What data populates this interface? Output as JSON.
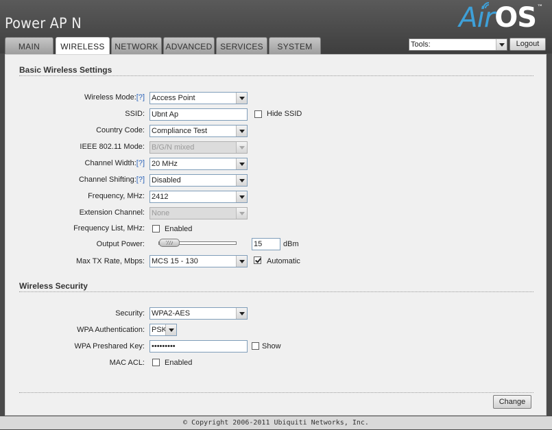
{
  "header": {
    "device_title": "Power AP N",
    "logo_air": "Air",
    "logo_os": "OS",
    "logo_tm": "™"
  },
  "tabs": [
    {
      "label": "MAIN",
      "active": false
    },
    {
      "label": "WIRELESS",
      "active": true
    },
    {
      "label": "NETWORK",
      "active": false
    },
    {
      "label": "ADVANCED",
      "active": false
    },
    {
      "label": "SERVICES",
      "active": false
    },
    {
      "label": "SYSTEM",
      "active": false
    }
  ],
  "toolbar": {
    "tools_value": "Tools:",
    "logout_label": "Logout"
  },
  "basic": {
    "title": "Basic Wireless Settings",
    "help": "[?]",
    "wireless_mode": {
      "label": "Wireless Mode:",
      "value": "Access Point"
    },
    "ssid": {
      "label": "SSID:",
      "value": "Ubnt Ap",
      "hide_label": "Hide SSID",
      "hide_checked": false
    },
    "country_code": {
      "label": "Country Code:",
      "value": "Compliance Test"
    },
    "ieee_mode": {
      "label": "IEEE 802.11 Mode:",
      "value": "B/G/N mixed"
    },
    "channel_width": {
      "label": "Channel Width:",
      "value": "20 MHz"
    },
    "channel_shifting": {
      "label": "Channel Shifting:",
      "value": "Disabled"
    },
    "frequency": {
      "label": "Frequency, MHz:",
      "value": "2412"
    },
    "extension_channel": {
      "label": "Extension Channel:",
      "value": "None"
    },
    "frequency_list": {
      "label": "Frequency List, MHz:",
      "enabled_label": "Enabled",
      "checked": false
    },
    "output_power": {
      "label": "Output Power:",
      "value": "15",
      "unit": "dBm"
    },
    "max_tx_rate": {
      "label": "Max TX Rate, Mbps:",
      "value": "MCS 15 - 130",
      "automatic_label": "Automatic",
      "automatic_checked": true
    }
  },
  "security": {
    "title": "Wireless Security",
    "security": {
      "label": "Security:",
      "value": "WPA2-AES"
    },
    "wpa_auth": {
      "label": "WPA Authentication:",
      "value": "PSK"
    },
    "psk": {
      "label": "WPA Preshared Key:",
      "value": "•••••••••",
      "show_label": "Show",
      "show_checked": false
    },
    "mac_acl": {
      "label": "MAC ACL:",
      "enabled_label": "Enabled",
      "checked": false
    }
  },
  "actions": {
    "change_label": "Change"
  },
  "footer": {
    "copyright": "© Copyright 2006-2011 Ubiquiti Networks, Inc."
  }
}
